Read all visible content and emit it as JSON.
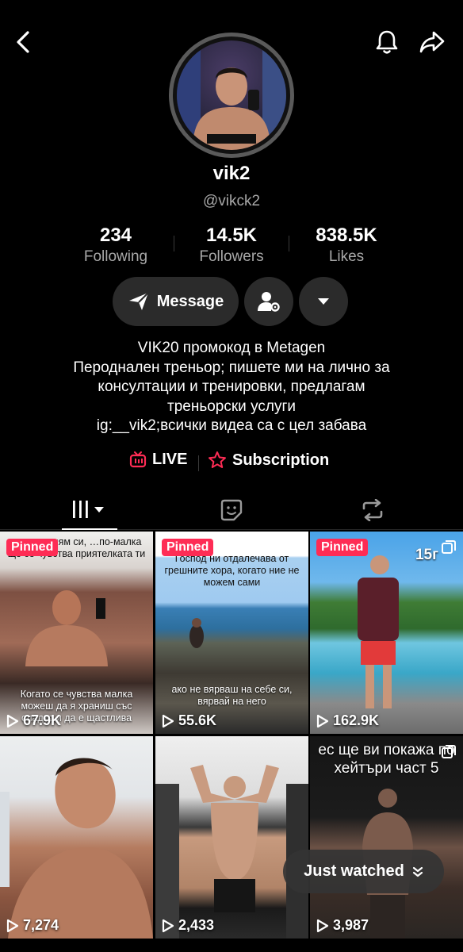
{
  "profile": {
    "username": "vik2",
    "handle": "@vikck2"
  },
  "stats": [
    {
      "value": "234",
      "label": "Following"
    },
    {
      "value": "14.5K",
      "label": "Followers"
    },
    {
      "value": "838.5K",
      "label": "Likes"
    }
  ],
  "actions": {
    "message_label": "Message"
  },
  "bio": [
    "VIK20 промокод в Metagen",
    "Перодналeн треньор; пишете ми на лично за",
    "консултации и тренировки, предлагам",
    "треньорски услуги",
    "ig:__vik2;всички видеа са с цел забава"
  ],
  "links": {
    "live": "LIVE",
    "subscription": "Subscription"
  },
  "videos": [
    {
      "pinned": "Pinned",
      "views": "67.9K",
      "top_text": "…о по-голям си, …по-малка ще се чувства приятелката ти",
      "bottom_text": "Когато се чувства малка можеш да я храниш със сладко и да е щастлива"
    },
    {
      "pinned": "Pinned",
      "views": "55.6K",
      "top_text": "Господ ни отдалечава от грешните хора, когато ние не можем сами",
      "bottom_text": "ако не вярваш на себе си, вярвай на него"
    },
    {
      "pinned": "Pinned",
      "views": "162.9K",
      "overlay": "15г"
    },
    {
      "views": "7,274"
    },
    {
      "views": "2,433"
    },
    {
      "views": "3,987",
      "top_text": "ес ще ви покажа по хейтъри част 5"
    }
  ],
  "pinned_label": "Pinned",
  "just_watched": "Just watched",
  "colors": {
    "accent": "#fe2c55",
    "background": "#000000",
    "pill": "#2b2b2b"
  }
}
